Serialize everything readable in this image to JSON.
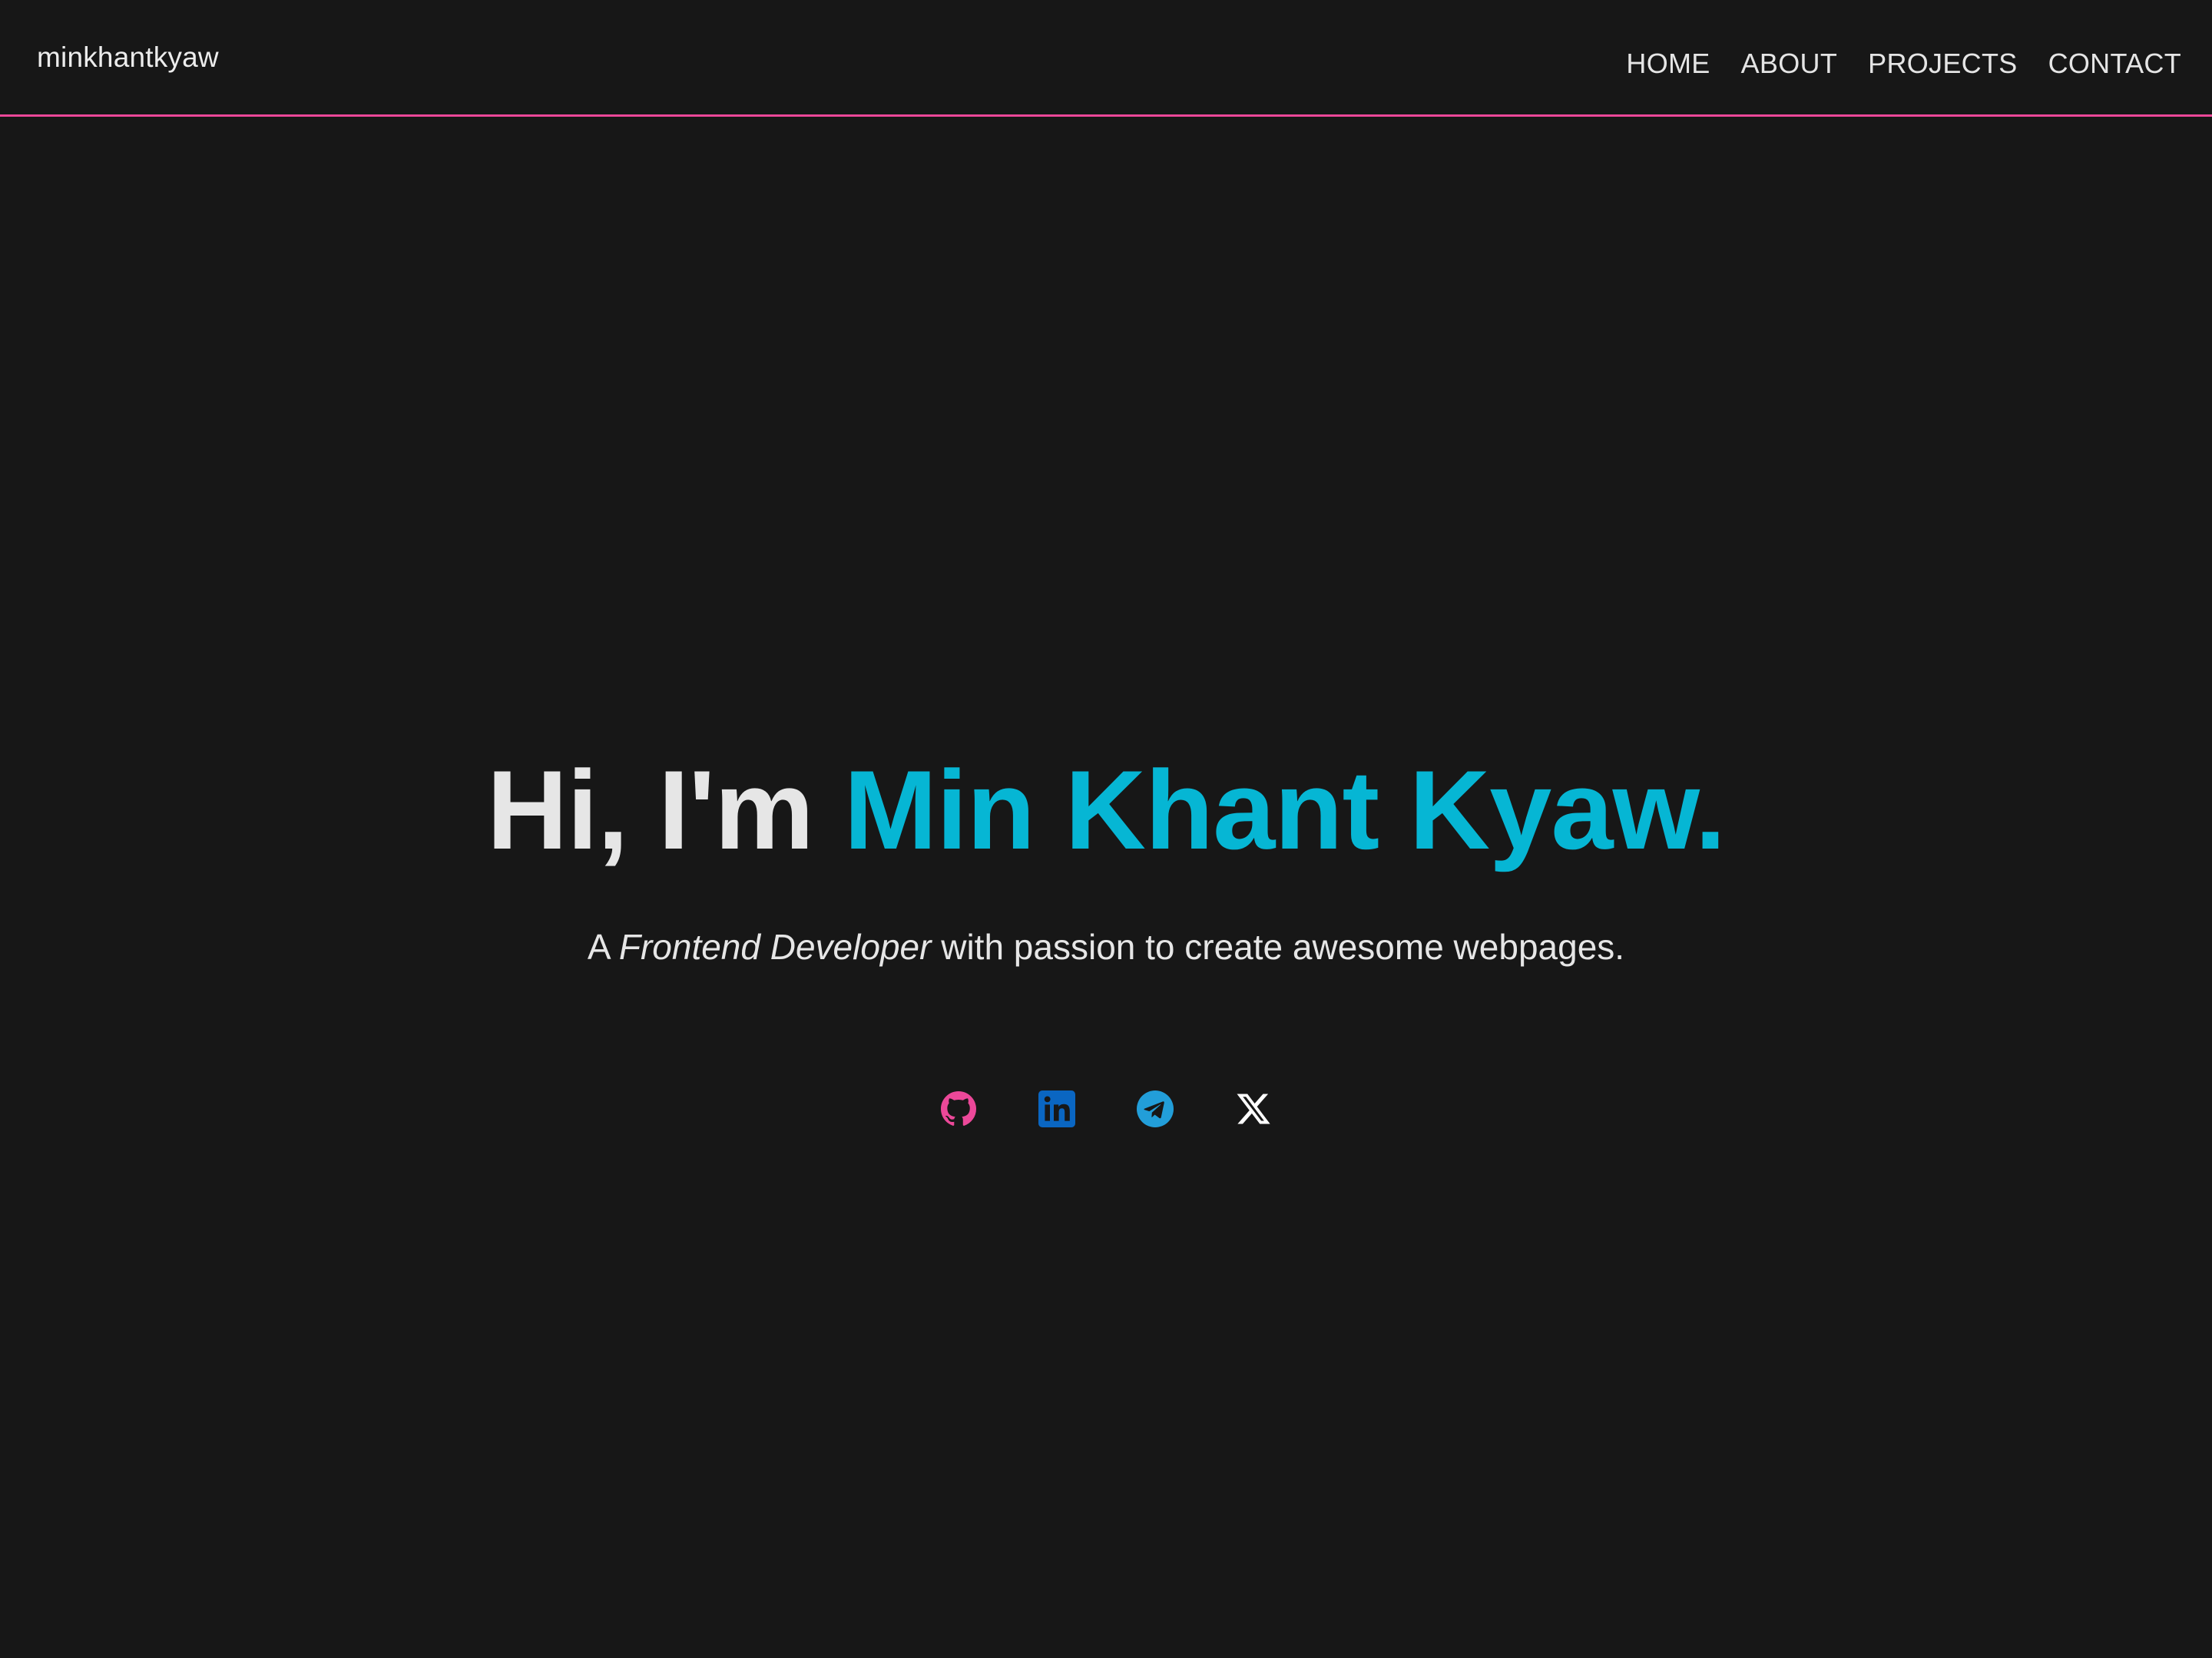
{
  "nav": {
    "brand": "minkhantkyaw",
    "links": [
      "HOME",
      "ABOUT",
      "PROJECTS",
      "CONTACT"
    ]
  },
  "hero": {
    "greeting": "Hi, I'm",
    "name": "Min Khant Kyaw.",
    "tagline": {
      "prefix": "A",
      "role": "Frontend Developer",
      "suffix": "with passion to create awesome webpages."
    }
  },
  "socials": [
    {
      "icon": "github-icon",
      "color": "#ec4899"
    },
    {
      "icon": "linkedin-icon",
      "color": "#0a66c2"
    },
    {
      "icon": "telegram-icon",
      "color": "#229ed9"
    },
    {
      "icon": "x-icon",
      "color": "#ffffff"
    }
  ],
  "colors": {
    "background": "#171717",
    "accent": "#06b6d4",
    "nav_border": "#ec4899",
    "text": "#e6e6e6"
  }
}
